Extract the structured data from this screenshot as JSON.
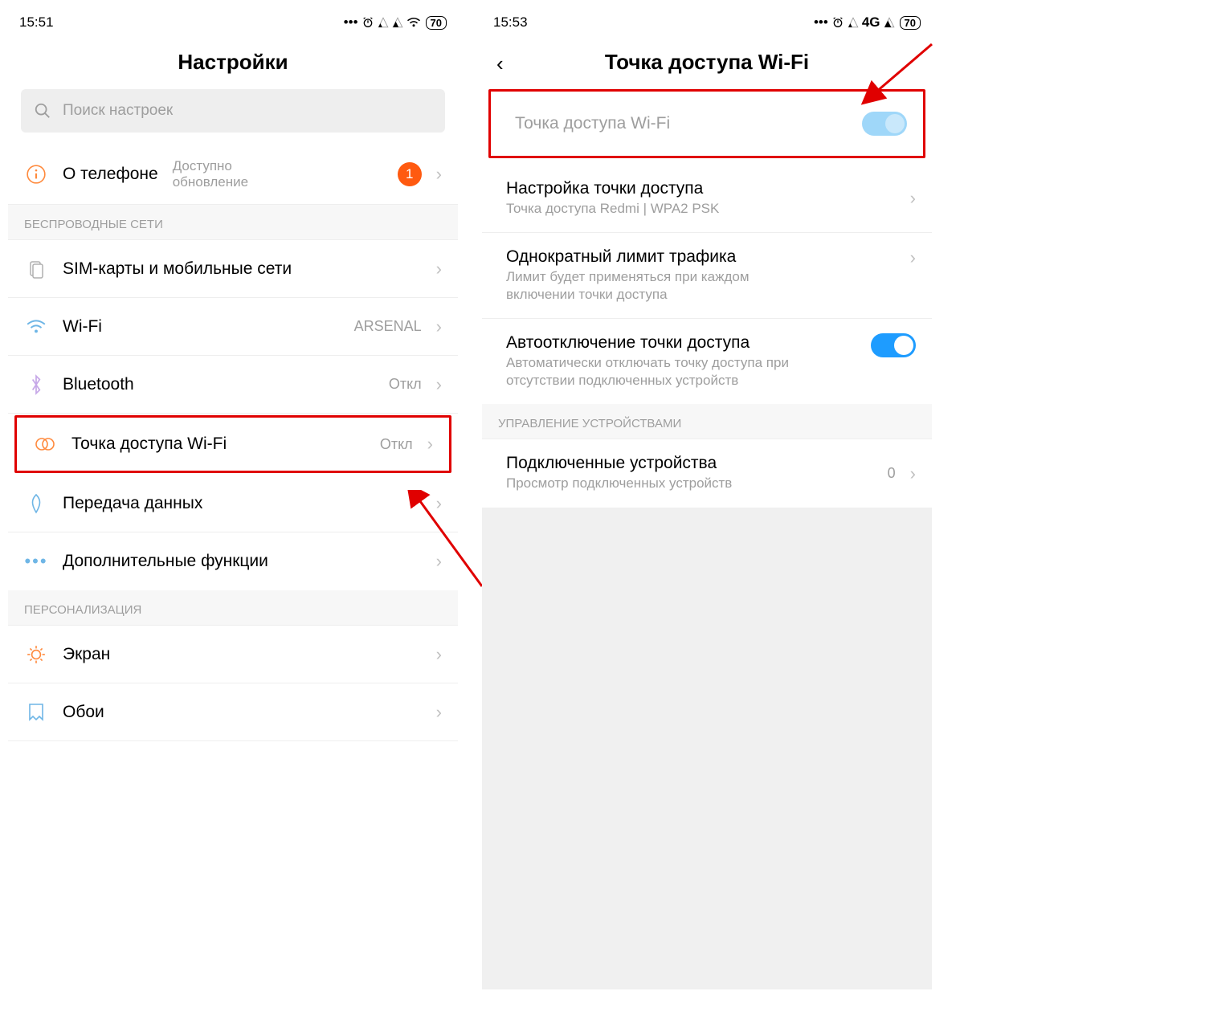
{
  "left": {
    "time": "15:51",
    "battery": "70",
    "title": "Настройки",
    "search_placeholder": "Поиск настроек",
    "about": {
      "label": "О телефоне",
      "update1": "Доступно",
      "update2": "обновление",
      "badge": "1"
    },
    "section_wireless": "БЕСПРОВОДНЫЕ СЕТИ",
    "sim": "SIM-карты и мобильные сети",
    "wifi": {
      "label": "Wi-Fi",
      "value": "ARSENAL"
    },
    "bluetooth": {
      "label": "Bluetooth",
      "value": "Откл"
    },
    "hotspot": {
      "label": "Точка доступа Wi-Fi",
      "value": "Откл"
    },
    "data": "Передача данных",
    "more": "Дополнительные функции",
    "section_pers": "ПЕРСОНАЛИЗАЦИЯ",
    "screen": "Экран",
    "wallpaper": "Обои"
  },
  "right": {
    "time": "15:53",
    "net": "4G",
    "battery": "70",
    "title": "Точка доступа Wi-Fi",
    "toggle_label": "Точка доступа Wi-Fi",
    "setup": {
      "label": "Настройка точки доступа",
      "sub": "Точка доступа Redmi | WPA2 PSK"
    },
    "limit": {
      "label": "Однократный лимит трафика",
      "sub": "Лимит будет применяться при каждом включении точки доступа"
    },
    "auto_off": {
      "label": "Автоотключение точки доступа",
      "sub": "Автоматически отключать точку доступа при отсутствии подключенных устройств"
    },
    "section_dev": "УПРАВЛЕНИЕ УСТРОЙСТВАМИ",
    "connected": {
      "label": "Подключенные устройства",
      "sub": "Просмотр подключенных устройств",
      "value": "0"
    }
  }
}
